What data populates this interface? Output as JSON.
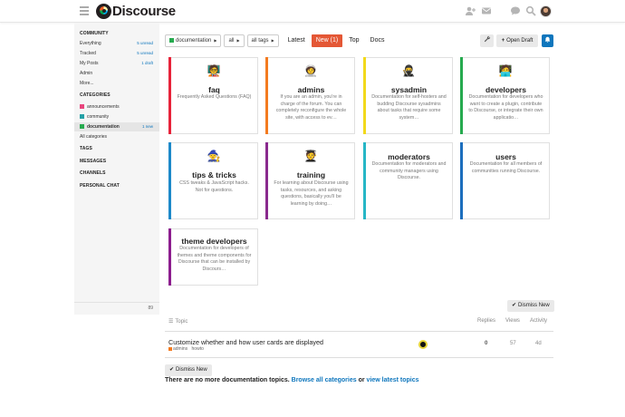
{
  "header": {
    "brand": "Discourse",
    "icons": [
      "hamburger-icon",
      "users-icon",
      "envelope-icon",
      "chat-icon",
      "search-icon",
      "avatar"
    ]
  },
  "sidebar": {
    "community_title": "COMMUNITY",
    "community": [
      {
        "label": "Everything",
        "count": "5 unread"
      },
      {
        "label": "Tracked",
        "count": "5 unread"
      },
      {
        "label": "My Posts",
        "count": "1 draft"
      },
      {
        "label": "Admin",
        "count": ""
      },
      {
        "label": "More...",
        "count": ""
      }
    ],
    "categories_title": "CATEGORIES",
    "categories": [
      {
        "label": "announcements",
        "color": "#e9457d",
        "count": ""
      },
      {
        "label": "community",
        "color": "#25a1a6",
        "count": ""
      },
      {
        "label": "documentation",
        "color": "#27aa4f",
        "count": "1 new"
      }
    ],
    "all_categories": "All categories",
    "tags": "TAGS",
    "messages": "MESSAGES",
    "channels": "CHANNELS",
    "personal_chat": "PERSONAL CHAT",
    "footer_icon": "89"
  },
  "nav": {
    "category_filter": "documentation",
    "category_color": "#27aa4f",
    "sub_filter": "all",
    "tags_filter": "all tags",
    "tabs": [
      "Latest",
      "New (1)",
      "Top",
      "Docs"
    ],
    "active_tab": 1,
    "open_draft": "Open Draft"
  },
  "categories": [
    {
      "name": "faq",
      "description": "Frequently Asked Questions (FAQ)",
      "color": "#e7233a",
      "icon": "🧑‍🏫"
    },
    {
      "name": "admins",
      "description": "If you are an admin, you're in charge of the forum. You can completely reconfigure the whole site, with access to ev…",
      "color": "#f37b20",
      "icon": "🧑‍🚀"
    },
    {
      "name": "sysadmin",
      "description": "Documentation for self-hosters and budding Discourse sysadmins about tasks that require some system…",
      "color": "#f2d91b",
      "icon": "🥷"
    },
    {
      "name": "developers",
      "description": "Documentation for developers who want to create a plugin, contribute to Discourse, or integrate their own applicatio…",
      "color": "#26aa4f",
      "icon": "🧑‍💻"
    },
    {
      "name": "tips & tricks",
      "description": "CSS tweaks & JavaScript hacks. Not for questions.",
      "color": "#1d89c9",
      "icon": "🧙"
    },
    {
      "name": "training",
      "description": "For learning about Discourse using tasks, resources, and asking questions, basically you'll be learning by doing…",
      "color": "#8a2a8e",
      "icon": "🧑‍🎓"
    },
    {
      "name": "moderators",
      "description": "Documentation for moderators and community managers using Discourse.",
      "color": "#26b6c6",
      "icon": ""
    },
    {
      "name": "users",
      "description": "Documentation for all members of communities running Discourse.",
      "color": "#1c6ebd",
      "icon": ""
    },
    {
      "name": "theme developers",
      "description": "Documentation for developers of themes and theme components for Discourse that can be installed by Discours…",
      "color": "#8c1d8e",
      "icon": ""
    }
  ],
  "topics": {
    "dismiss_label": "Dismiss New",
    "columns": [
      "Topic",
      "Replies",
      "Views",
      "Activity"
    ],
    "rows": [
      {
        "title": "Customize whether and how user cards are displayed",
        "category": "admins",
        "category_color": "#f37b20",
        "tag": "howto",
        "replies": "0",
        "views": "57",
        "activity": "4d"
      }
    ],
    "no_more_prefix": "There are no more documentation topics.",
    "browse_link": "Browse all categories",
    "or_text": "or",
    "latest_link": "view latest topics"
  }
}
